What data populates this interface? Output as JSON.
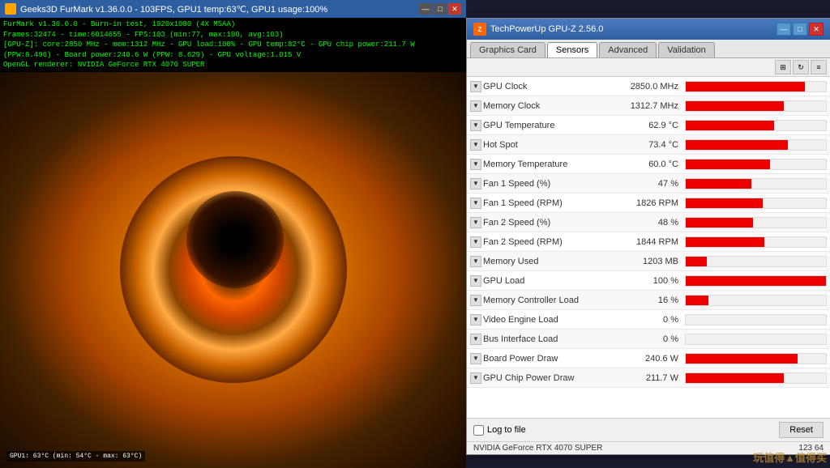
{
  "furmark": {
    "title": "Geeks3D FurMark v1.36.0.0 - 103FPS, GPU1 temp:63℃, GPU1 usage:100%",
    "info_lines": [
      "FurMark v1.36.0.0 - Burn-in test, 1920x1080 (4X MSAA)",
      "Frames:32474 - time:6014655 - FPS:103 (min:77, max:108, avg:103)",
      "[GPU-Z]: core:2850 MHz - mem:1312 MHz - GPU load:100% - GPU temp:82°C - GPU chip power:211.7 W (PPW:8.496) - Board power:240.6 W (PPW: 8.629) - GPU voltage:1.015 V",
      "OpenGL renderer: NVIDIA GeForce RTX 4070 SUPER"
    ],
    "overlay_text": "GPU1: 63°C (min: 54°C - max: 63°C)"
  },
  "gpuz": {
    "title": "TechPowerUp GPU-Z 2.56.0",
    "tabs": [
      "Graphics Card",
      "Sensors",
      "Advanced",
      "Validation"
    ],
    "active_tab": "Sensors",
    "toolbar_icons": [
      "grid-icon",
      "refresh-icon",
      "menu-icon"
    ],
    "sensors": [
      {
        "name": "GPU Clock",
        "value": "2850.0 MHz",
        "bar_pct": 85
      },
      {
        "name": "Memory Clock",
        "value": "1312.7 MHz",
        "bar_pct": 70
      },
      {
        "name": "GPU Temperature",
        "value": "62.9 °C",
        "bar_pct": 63
      },
      {
        "name": "Hot Spot",
        "value": "73.4 °C",
        "bar_pct": 73
      },
      {
        "name": "Memory Temperature",
        "value": "60.0 °C",
        "bar_pct": 60
      },
      {
        "name": "Fan 1 Speed (%)",
        "value": "47 %",
        "bar_pct": 47
      },
      {
        "name": "Fan 1 Speed (RPM)",
        "value": "1826 RPM",
        "bar_pct": 55
      },
      {
        "name": "Fan 2 Speed (%)",
        "value": "48 %",
        "bar_pct": 48
      },
      {
        "name": "Fan 2 Speed (RPM)",
        "value": "1844 RPM",
        "bar_pct": 56
      },
      {
        "name": "Memory Used",
        "value": "1203 MB",
        "bar_pct": 15
      },
      {
        "name": "GPU Load",
        "value": "100 %",
        "bar_pct": 100
      },
      {
        "name": "Memory Controller Load",
        "value": "16 %",
        "bar_pct": 16
      },
      {
        "name": "Video Engine Load",
        "value": "0 %",
        "bar_pct": 0
      },
      {
        "name": "Bus Interface Load",
        "value": "0 %",
        "bar_pct": 0
      },
      {
        "name": "Board Power Draw",
        "value": "240.6 W",
        "bar_pct": 80
      },
      {
        "name": "GPU Chip Power Draw",
        "value": "211.7 W",
        "bar_pct": 70
      }
    ],
    "footer": {
      "log_label": "Log to file",
      "reset_label": "Reset"
    },
    "status_bar": {
      "gpu_name": "NVIDIA GeForce RTX 4070 SUPER",
      "right_text": "123 64"
    }
  },
  "watermark": {
    "text": "玩值得▲值得买"
  }
}
